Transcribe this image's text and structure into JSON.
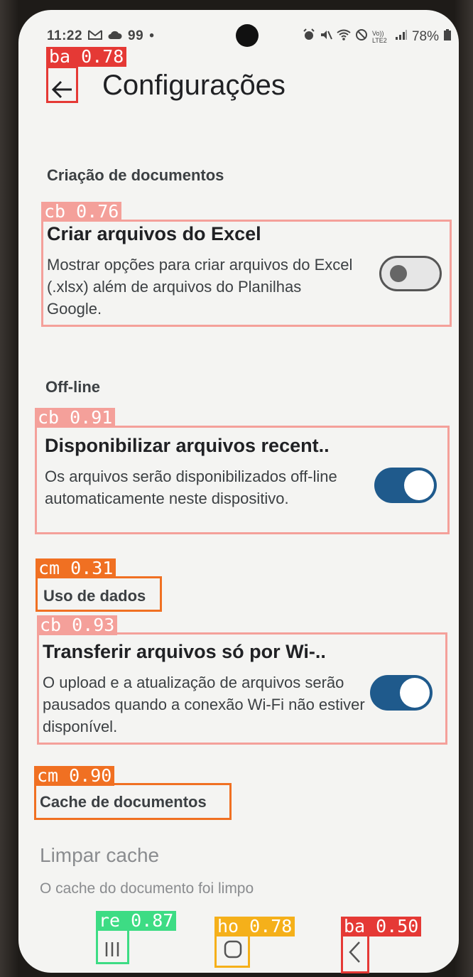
{
  "status_bar": {
    "time": "11:22",
    "notif_count": "99",
    "dot": "•",
    "battery": "78%",
    "lte_label": "Vo)) LTE2"
  },
  "app_bar": {
    "title": "Configurações",
    "back_icon": "arrow-left-icon"
  },
  "sections": {
    "doc_creation": {
      "header": "Criação de documentos",
      "item": {
        "title": "Criar arquivos do Excel",
        "desc": "Mostrar opções para criar arquivos do Excel (.xlsx) além de arquivos do Planilhas Google.",
        "toggle": "off"
      }
    },
    "offline": {
      "header": "Off-line",
      "item": {
        "title": "Disponibilizar arquivos recent..",
        "desc": "Os arquivos serão disponibilizados off-line automaticamente neste dispositivo.",
        "toggle": "on"
      }
    },
    "data_usage": {
      "header": "Uso de dados",
      "item": {
        "title": "Transferir arquivos só por Wi-..",
        "desc": "O upload e a atualização de arquivos serão pausados quando a conexão Wi-Fi não estiver disponível.",
        "toggle": "on"
      }
    },
    "cache": {
      "header": "Cache de documentos",
      "item": {
        "title": "Limpar cache",
        "desc": "O cache do documento foi limpo"
      }
    }
  },
  "nav_bar": {
    "recents_icon": "recents-icon",
    "home_icon": "home-icon",
    "back_icon": "back-chevron-icon"
  },
  "detections": [
    {
      "label": "ba 0.78",
      "color": "#e53935"
    },
    {
      "label": "cb 0.76",
      "color": "#f4a09a"
    },
    {
      "label": "cb 0.91",
      "color": "#f4a09a"
    },
    {
      "label": "cm 0.31",
      "color": "#f07022"
    },
    {
      "label": "cb 0.93",
      "color": "#f4a09a"
    },
    {
      "label": "cm 0.90",
      "color": "#f07022"
    },
    {
      "label": "re 0.87",
      "color": "#3ddc84"
    },
    {
      "label": "ho 0.78",
      "color": "#f5b01a"
    },
    {
      "label": "ba 0.50",
      "color": "#e53935"
    }
  ],
  "colors": {
    "toggle_on": "#1f5a8c",
    "toggle_off_bg": "#e6e6e6"
  }
}
